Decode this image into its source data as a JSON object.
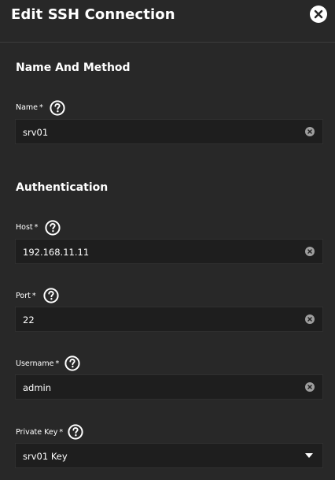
{
  "dialog": {
    "title": "Edit SSH Connection",
    "close_icon": "close-circle-icon"
  },
  "sections": {
    "name_method": "Name And Method",
    "authentication": "Authentication"
  },
  "fields": {
    "name": {
      "label": "Name",
      "required": "*",
      "value": "srv01"
    },
    "host": {
      "label": "Host",
      "required": "*",
      "value": "192.168.11.11"
    },
    "port": {
      "label": "Port",
      "required": "*",
      "value": "22"
    },
    "username": {
      "label": "Username",
      "required": "*",
      "value": "admin"
    },
    "private_key": {
      "label": "Private Key",
      "required": "*",
      "selected": "srv01 Key"
    }
  },
  "colors": {
    "background": "#282828",
    "input_background": "#1e1e1e",
    "text": "#ffffff",
    "clear_icon": "#9e9e9e"
  }
}
